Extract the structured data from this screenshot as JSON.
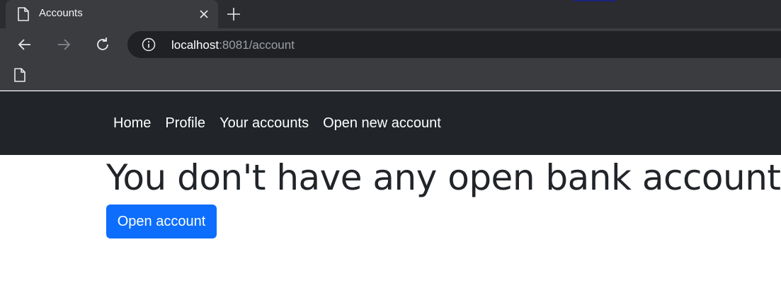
{
  "browser": {
    "tab": {
      "title": "Accounts"
    },
    "address_bar": {
      "host": "localhost",
      "rest": ":8081/account"
    },
    "icons": {
      "tab": "page-icon",
      "close": "close-icon",
      "new_tab": "plus-icon",
      "back": "back-arrow-icon",
      "forward": "forward-arrow-icon",
      "reload": "reload-icon",
      "site_info": "info-icon",
      "bookmark": "page-icon"
    }
  },
  "navbar": {
    "links": [
      "Home",
      "Profile",
      "Your accounts",
      "Open new account"
    ]
  },
  "main": {
    "heading": "You don't have any open bank accounts",
    "button_label": "Open account"
  },
  "colors": {
    "navbar_bg": "#212529",
    "primary": "#0d6efd",
    "text": "#212529"
  }
}
